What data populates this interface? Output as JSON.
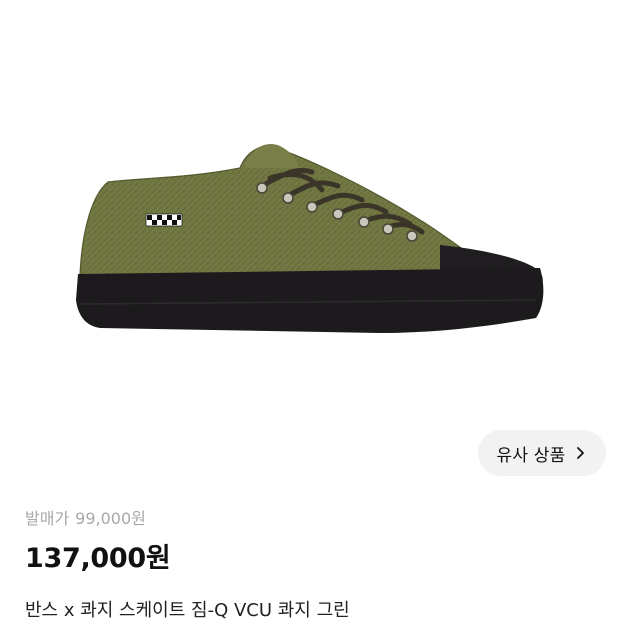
{
  "product_image": {
    "icon": "sneaker-product-photo",
    "colors": {
      "suede": "#6e7440",
      "suede_dark": "#596032",
      "sole": "#1c1a1c",
      "lace": "#3a3528",
      "eyelet": "#c9c6bb"
    }
  },
  "similar_products_button": {
    "label": "유사 상품",
    "icon": "chevron-right-icon"
  },
  "pricing": {
    "release_label": "발매가",
    "release_price": "99,000원",
    "current_price": "137,000원"
  },
  "product": {
    "name": "반스 x 콰지 스케이트 짐-Q VCU 콰지 그린"
  }
}
